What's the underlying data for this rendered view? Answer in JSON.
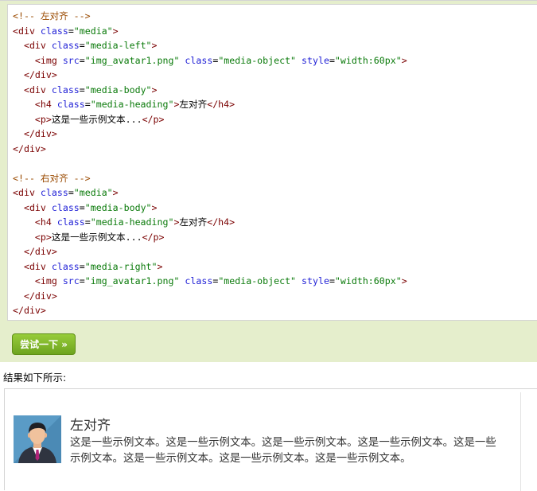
{
  "code_lines": [
    [
      [
        "comment",
        "<!-- 左对齐 -->"
      ]
    ],
    [
      [
        "tag",
        "<div "
      ],
      [
        "attr",
        "class"
      ],
      [
        "text",
        "="
      ],
      [
        "val",
        "\"media\""
      ],
      [
        "tag",
        ">"
      ]
    ],
    [
      [
        "text",
        "  "
      ],
      [
        "tag",
        "<div "
      ],
      [
        "attr",
        "class"
      ],
      [
        "text",
        "="
      ],
      [
        "val",
        "\"media-left\""
      ],
      [
        "tag",
        ">"
      ]
    ],
    [
      [
        "text",
        "    "
      ],
      [
        "tag",
        "<img "
      ],
      [
        "attr",
        "src"
      ],
      [
        "text",
        "="
      ],
      [
        "val",
        "\"img_avatar1.png\""
      ],
      [
        "text",
        " "
      ],
      [
        "attr",
        "class"
      ],
      [
        "text",
        "="
      ],
      [
        "val",
        "\"media-object\""
      ],
      [
        "text",
        " "
      ],
      [
        "attr",
        "style"
      ],
      [
        "text",
        "="
      ],
      [
        "val",
        "\"width:60px\""
      ],
      [
        "tag",
        ">"
      ]
    ],
    [
      [
        "text",
        "  "
      ],
      [
        "tag",
        "</div>"
      ]
    ],
    [
      [
        "text",
        "  "
      ],
      [
        "tag",
        "<div "
      ],
      [
        "attr",
        "class"
      ],
      [
        "text",
        "="
      ],
      [
        "val",
        "\"media-body\""
      ],
      [
        "tag",
        ">"
      ]
    ],
    [
      [
        "text",
        "    "
      ],
      [
        "tag",
        "<h4 "
      ],
      [
        "attr",
        "class"
      ],
      [
        "text",
        "="
      ],
      [
        "val",
        "\"media-heading\""
      ],
      [
        "tag",
        ">"
      ],
      [
        "text",
        "左对齐"
      ],
      [
        "tag",
        "</h4>"
      ]
    ],
    [
      [
        "text",
        "    "
      ],
      [
        "tag",
        "<p>"
      ],
      [
        "text",
        "这是一些示例文本..."
      ],
      [
        "tag",
        "</p>"
      ]
    ],
    [
      [
        "text",
        "  "
      ],
      [
        "tag",
        "</div>"
      ]
    ],
    [
      [
        "tag",
        "</div>"
      ]
    ],
    [
      [
        "text",
        ""
      ]
    ],
    [
      [
        "comment",
        "<!-- 右对齐 -->"
      ]
    ],
    [
      [
        "tag",
        "<div "
      ],
      [
        "attr",
        "class"
      ],
      [
        "text",
        "="
      ],
      [
        "val",
        "\"media\""
      ],
      [
        "tag",
        ">"
      ]
    ],
    [
      [
        "text",
        "  "
      ],
      [
        "tag",
        "<div "
      ],
      [
        "attr",
        "class"
      ],
      [
        "text",
        "="
      ],
      [
        "val",
        "\"media-body\""
      ],
      [
        "tag",
        ">"
      ]
    ],
    [
      [
        "text",
        "    "
      ],
      [
        "tag",
        "<h4 "
      ],
      [
        "attr",
        "class"
      ],
      [
        "text",
        "="
      ],
      [
        "val",
        "\"media-heading\""
      ],
      [
        "tag",
        ">"
      ],
      [
        "text",
        "左对齐"
      ],
      [
        "tag",
        "</h4>"
      ]
    ],
    [
      [
        "text",
        "    "
      ],
      [
        "tag",
        "<p>"
      ],
      [
        "text",
        "这是一些示例文本..."
      ],
      [
        "tag",
        "</p>"
      ]
    ],
    [
      [
        "text",
        "  "
      ],
      [
        "tag",
        "</div>"
      ]
    ],
    [
      [
        "text",
        "  "
      ],
      [
        "tag",
        "<div "
      ],
      [
        "attr",
        "class"
      ],
      [
        "text",
        "="
      ],
      [
        "val",
        "\"media-right\""
      ],
      [
        "tag",
        ">"
      ]
    ],
    [
      [
        "text",
        "    "
      ],
      [
        "tag",
        "<img "
      ],
      [
        "attr",
        "src"
      ],
      [
        "text",
        "="
      ],
      [
        "val",
        "\"img_avatar1.png\""
      ],
      [
        "text",
        " "
      ],
      [
        "attr",
        "class"
      ],
      [
        "text",
        "="
      ],
      [
        "val",
        "\"media-object\""
      ],
      [
        "text",
        " "
      ],
      [
        "attr",
        "style"
      ],
      [
        "text",
        "="
      ],
      [
        "val",
        "\"width:60px\""
      ],
      [
        "tag",
        ">"
      ]
    ],
    [
      [
        "text",
        "  "
      ],
      [
        "tag",
        "</div>"
      ]
    ],
    [
      [
        "tag",
        "</div>"
      ]
    ]
  ],
  "try_button": {
    "label": "尝试一下 »"
  },
  "caption": "结果如下所示:",
  "result": {
    "heading": "左对齐",
    "text": "这是一些示例文本。这是一些示例文本。这是一些示例文本。这是一些示例文本。这是一些示例文本。这是一些示例文本。这是一些示例文本。这是一些示例文本。"
  },
  "colors": {
    "panel_bg": "#e5eecc",
    "button_green": "#7cb225",
    "comment": "#9a4a00",
    "tag": "#7a0000",
    "attr": "#1f1fd6",
    "value": "#0a7a0a"
  }
}
